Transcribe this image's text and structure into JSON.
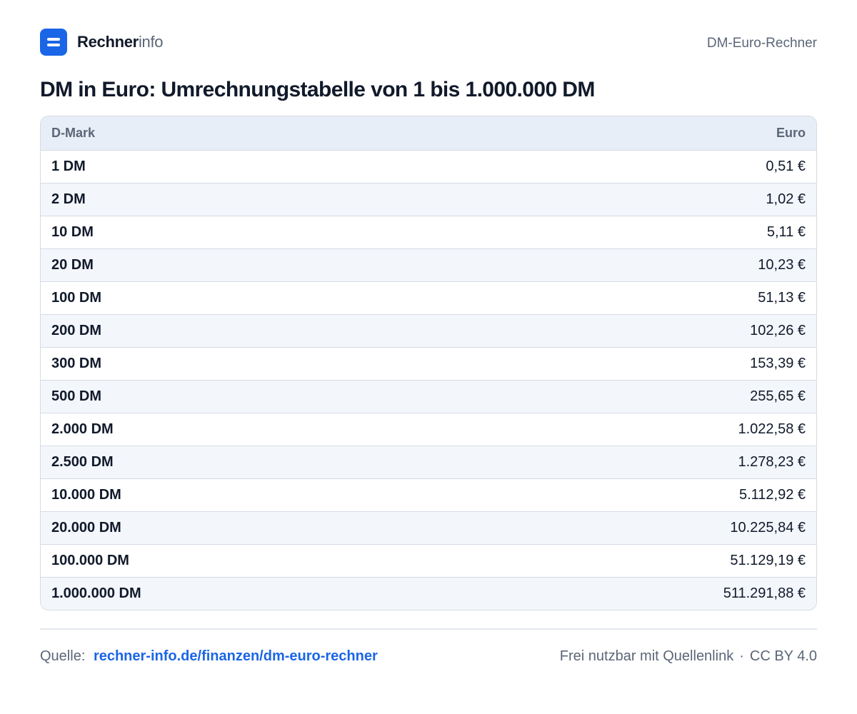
{
  "header": {
    "brand_strong": "Rechner",
    "brand_light": "info",
    "right_label": "DM-Euro-Rechner"
  },
  "title": "DM in Euro: Umrechnungstabelle von 1 bis 1.000.000 DM",
  "table": {
    "columns": [
      "D-Mark",
      "Euro"
    ],
    "rows": [
      {
        "dm": "1 DM",
        "eur": "0,51 €"
      },
      {
        "dm": "2 DM",
        "eur": "1,02 €"
      },
      {
        "dm": "10 DM",
        "eur": "5,11 €"
      },
      {
        "dm": "20 DM",
        "eur": "10,23 €"
      },
      {
        "dm": "100 DM",
        "eur": "51,13 €"
      },
      {
        "dm": "200 DM",
        "eur": "102,26 €"
      },
      {
        "dm": "300 DM",
        "eur": "153,39 €"
      },
      {
        "dm": "500 DM",
        "eur": "255,65 €"
      },
      {
        "dm": "2.000 DM",
        "eur": "1.022,58 €"
      },
      {
        "dm": "2.500 DM",
        "eur": "1.278,23 €"
      },
      {
        "dm": "10.000 DM",
        "eur": "5.112,92 €"
      },
      {
        "dm": "20.000 DM",
        "eur": "10.225,84 €"
      },
      {
        "dm": "100.000 DM",
        "eur": "51.129,19 €"
      },
      {
        "dm": "1.000.000 DM",
        "eur": "511.291,88 €"
      }
    ]
  },
  "footer": {
    "source_label": "Quelle:",
    "source_link": "rechner-info.de/finanzen/dm-euro-rechner",
    "license_text": "Frei nutzbar mit Quellenlink",
    "separator": "·",
    "license": "CC BY 4.0"
  },
  "colors": {
    "accent": "#1a66e6",
    "text": "#111a2b",
    "muted": "#5b6678",
    "header_bg": "#e8eef7",
    "row_alt_bg": "#f3f6fb",
    "border": "#d5dbe5"
  }
}
